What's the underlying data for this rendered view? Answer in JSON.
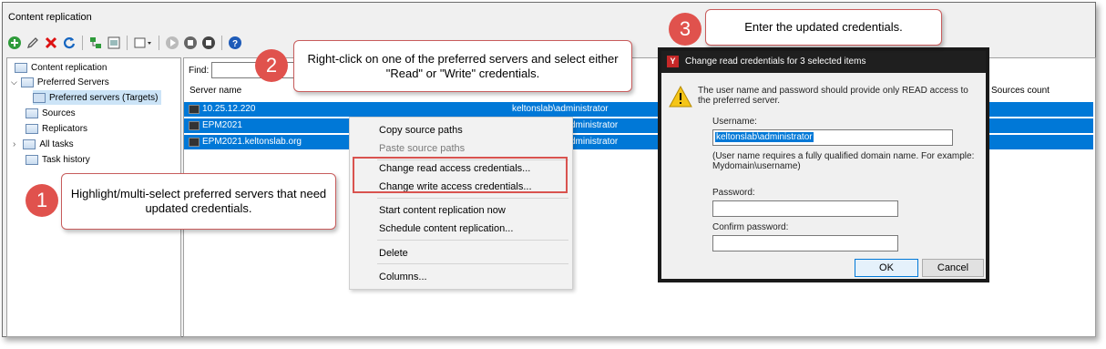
{
  "window": {
    "title": "Content replication"
  },
  "toolbar": {
    "icons": [
      "add-icon",
      "edit-icon",
      "delete-icon",
      "refresh-icon",
      "network-icon",
      "properties-icon",
      "view-dropdown-icon",
      "start-icon",
      "stop-icon",
      "record-icon",
      "help-icon"
    ]
  },
  "tree": {
    "items": [
      {
        "label": "Content replication"
      },
      {
        "label": "Preferred Servers"
      },
      {
        "label": "Preferred servers (Targets)"
      },
      {
        "label": "Sources"
      },
      {
        "label": "Replicators"
      },
      {
        "label": "All tasks"
      },
      {
        "label": "Task history"
      }
    ]
  },
  "main": {
    "find_label": "Find:",
    "columns": [
      "Server name",
      "Sources count"
    ],
    "rows": [
      {
        "name": "10.25.12.220",
        "user": "keltonslab\\administrator"
      },
      {
        "name": "EPM2021",
        "user": "dministrator"
      },
      {
        "name": "EPM2021.keltonslab.org",
        "user": "dministrator"
      }
    ]
  },
  "context_menu": {
    "items": [
      {
        "label": "Copy source paths"
      },
      {
        "label": "Paste source paths"
      },
      {
        "label": "Change read access credentials..."
      },
      {
        "label": "Change write access credentials..."
      },
      {
        "label": "Start content replication now"
      },
      {
        "label": "Schedule content replication..."
      },
      {
        "label": "Delete"
      },
      {
        "label": "Columns..."
      }
    ]
  },
  "dialog": {
    "title": "Change read credentials for 3 selected items",
    "message": "The user name and password should provide only READ access to the preferred server.",
    "username_label": "Username:",
    "username_value": "keltonslab\\administrator",
    "hint": "(User name requires a fully qualified domain name. For example: Mydomain\\username)",
    "password_label": "Password:",
    "confirm_label": "Confirm password:",
    "ok_label": "OK",
    "cancel_label": "Cancel"
  },
  "callouts": [
    {
      "number": "1",
      "text": "Highlight/multi-select preferred servers that need updated credentials."
    },
    {
      "number": "2",
      "text": "Right-click on one of the preferred servers and select either \"Read\" or \"Write\" credentials."
    },
    {
      "number": "3",
      "text": "Enter the updated credentials."
    }
  ],
  "colors": {
    "selection": "#0078d7",
    "callout_badge": "#e0524d",
    "highlight_border": "#d9534f"
  }
}
